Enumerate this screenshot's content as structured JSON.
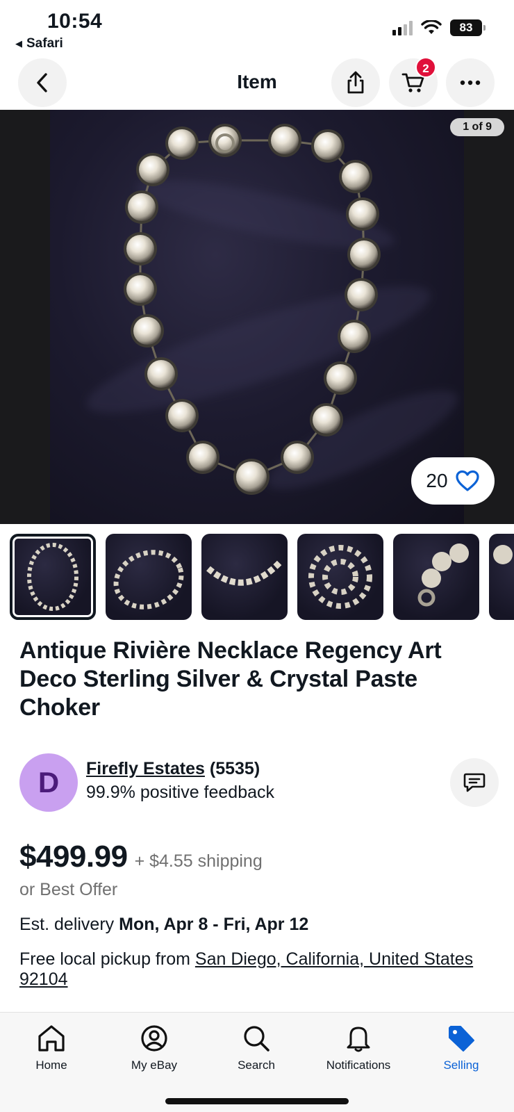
{
  "status_bar": {
    "time": "10:54",
    "back_app": "Safari",
    "battery": "83"
  },
  "header": {
    "title": "Item",
    "cart_count": "2",
    "icons": [
      "back-chevron-icon",
      "share-icon",
      "cart-icon",
      "more-icon"
    ]
  },
  "gallery": {
    "counter": "1 of 9",
    "watchers": "20",
    "thumbnail_count_visible": 6,
    "selected_index": 0
  },
  "listing": {
    "title": "Antique Rivière Necklace Regency Art Deco Sterling Silver & Crystal Paste Choker"
  },
  "seller": {
    "avatar_letter": "D",
    "name": "Firefly Estates",
    "feedback_count": "(5535)",
    "feedback": "99.9% positive feedback"
  },
  "pricing": {
    "price": "$499.99",
    "shipping": "+ $4.55 shipping",
    "best_offer": "or Best Offer",
    "delivery_label": "Est. delivery",
    "delivery_dates": "Mon, Apr 8 - Fri, Apr 12",
    "pickup_label": "Free local pickup from",
    "pickup_location": "San Diego, California, United States 92104"
  },
  "bottom_nav": {
    "items": [
      {
        "label": "Home",
        "icon": "home-icon"
      },
      {
        "label": "My eBay",
        "icon": "user-icon"
      },
      {
        "label": "Search",
        "icon": "search-icon"
      },
      {
        "label": "Notifications",
        "icon": "bell-icon"
      },
      {
        "label": "Selling",
        "icon": "tag-icon"
      }
    ],
    "active": "Selling"
  },
  "colors": {
    "accent_blue": "#0b62d6",
    "badge_red": "#e0103a",
    "avatar_bg": "#c9a0f0",
    "text": "#111820",
    "muted": "#707070"
  }
}
